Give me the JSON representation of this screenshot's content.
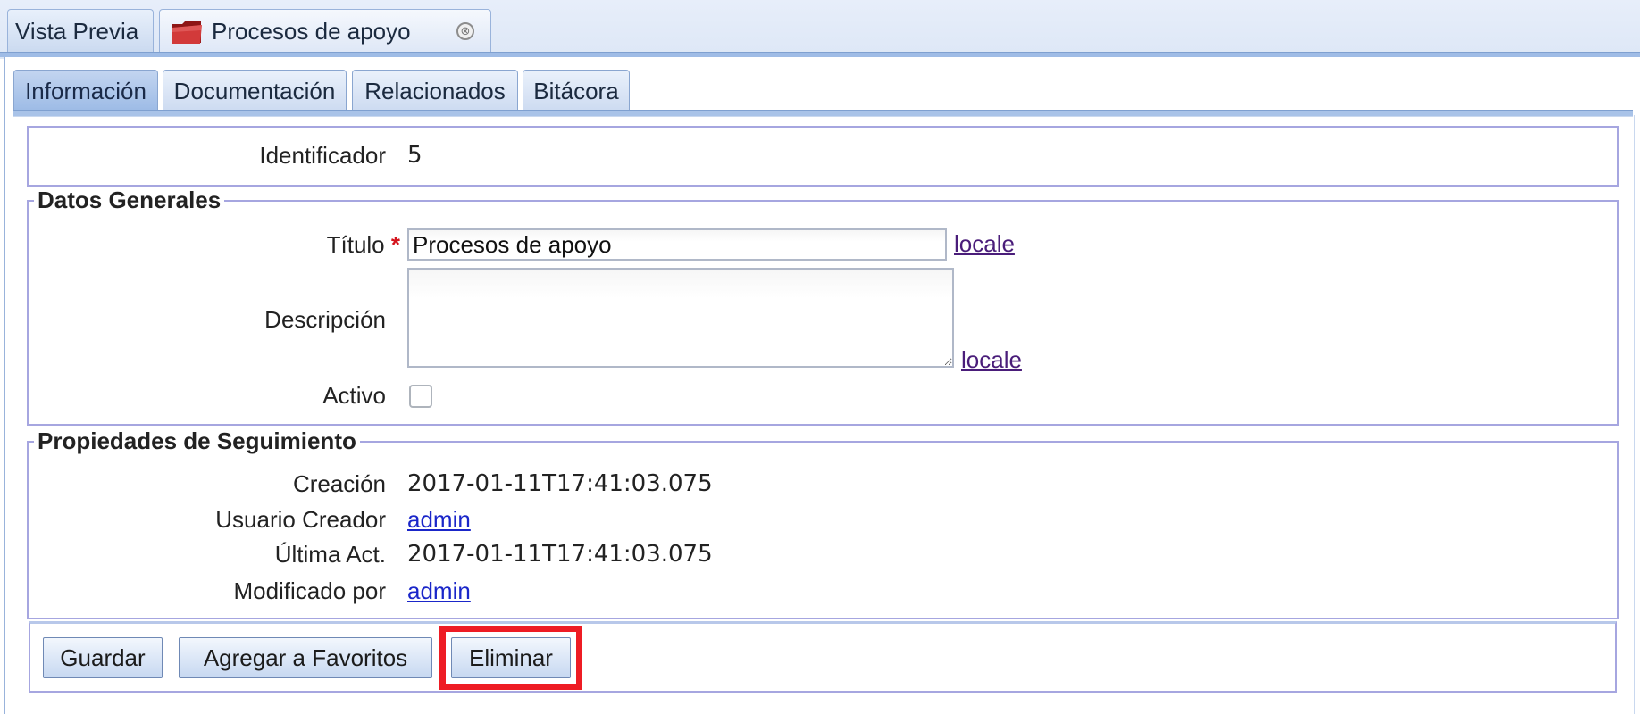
{
  "top_tabs": [
    {
      "label": "Vista Previa"
    },
    {
      "label": "Procesos de apoyo",
      "icon": "folder-icon",
      "close_icon": "close-icon",
      "close_glyph": "⊗"
    }
  ],
  "sub_tabs": [
    {
      "label": "Información",
      "active": true
    },
    {
      "label": "Documentación",
      "active": false
    },
    {
      "label": "Relacionados",
      "active": false
    },
    {
      "label": "Bitácora",
      "active": false
    }
  ],
  "identifier": {
    "label": "Identificador",
    "value": "5"
  },
  "general": {
    "legend": "Datos Generales",
    "title_label": "Título",
    "required_mark": "*",
    "title_value": "Procesos de apoyo",
    "locale_link": "locale",
    "description_label": "Descripción",
    "description_value": "",
    "description_locale_link": "locale",
    "active_label": "Activo",
    "active_checked": false
  },
  "tracking": {
    "legend": "Propiedades de Seguimiento",
    "created_label": "Creación",
    "created_value": "2017-01-11T17:41:03.075",
    "creator_label": "Usuario Creador",
    "creator_value": "admin",
    "updated_label": "Última Act.",
    "updated_value": "2017-01-11T17:41:03.075",
    "modified_by_label": "Modificado por",
    "modified_by_value": "admin"
  },
  "buttons": {
    "save": "Guardar",
    "favorites": "Agregar a Favoritos",
    "delete": "Eliminar"
  },
  "colors": {
    "highlight": "#ee1c24",
    "link": "#1a26c9",
    "visited_link": "#4a1d7a",
    "required": "#d4131c"
  }
}
